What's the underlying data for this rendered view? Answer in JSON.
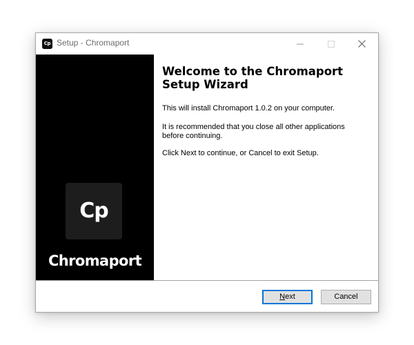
{
  "window": {
    "title": "Setup - Chromaport",
    "icon_text": "Cp",
    "icon_name": "chromaport-app-icon"
  },
  "caption_buttons": {
    "minimize_icon": "minimize-icon",
    "maximize_icon": "maximize-icon",
    "close_icon": "close-icon"
  },
  "side_panel": {
    "logo_text": "Cp",
    "brand_name": "Chromaport"
  },
  "content": {
    "heading": "Welcome to the Chromaport Setup Wizard",
    "paragraph_1": "This will install Chromaport 1.0.2 on your computer.",
    "paragraph_2": "It is recommended that you close all other applications before continuing.",
    "paragraph_3": "Click Next to continue, or Cancel to exit Setup."
  },
  "footer": {
    "next_mnemonic": "N",
    "next_rest": "ext",
    "cancel_label": "Cancel"
  },
  "colors": {
    "side_panel_bg": "#000000",
    "logo_tile_bg": "#1d1d1d",
    "default_button_border": "#0078d7",
    "button_bg": "#e1e1e1"
  }
}
